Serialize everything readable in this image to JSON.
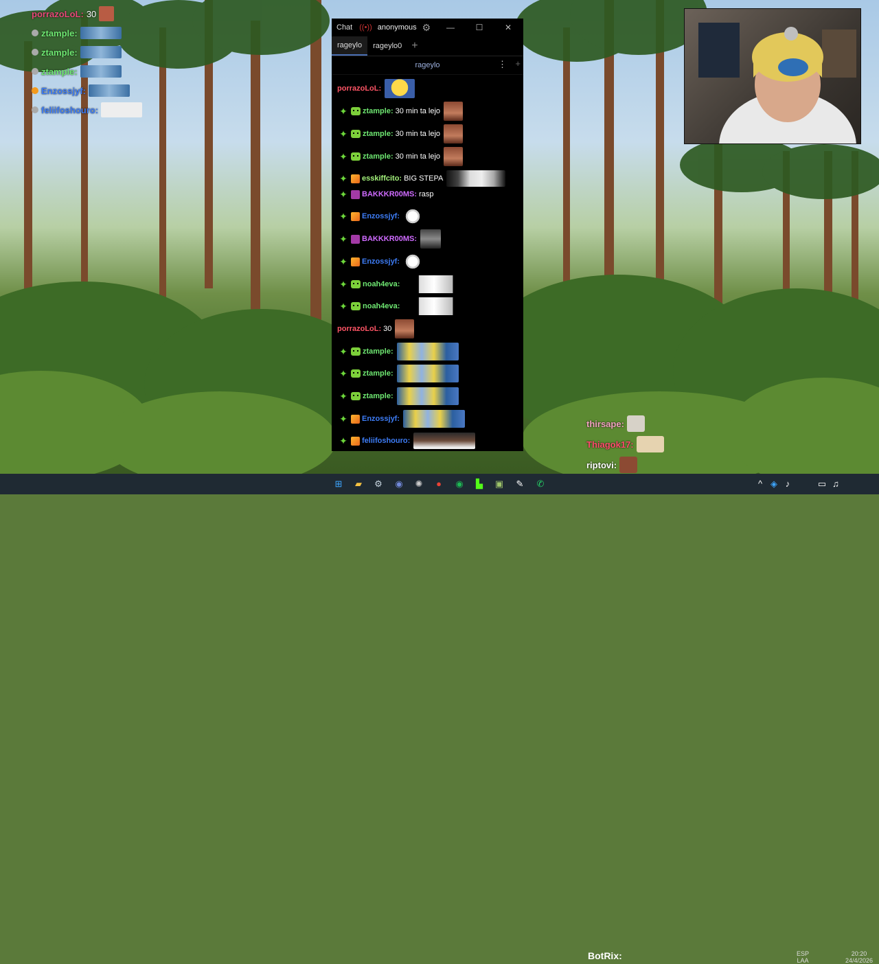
{
  "overlay_chat": [
    {
      "name": "porrazoLoL:",
      "message": "30"
    },
    {
      "name": "ztample:",
      "message": ""
    },
    {
      "name": "ztample:",
      "message": ""
    },
    {
      "name": "ztample:",
      "message": ""
    },
    {
      "name": "Enzossjyf:",
      "message": ""
    },
    {
      "name": "feliifoshouro:",
      "message": ""
    }
  ],
  "window": {
    "title": "Chat",
    "user": "anonymous",
    "tabs": [
      "rageylo",
      "rageylo0"
    ],
    "add_tab": "+",
    "channel": "rageylo",
    "more": "⋮",
    "add_split": "+"
  },
  "messages": [
    {
      "user": "porrazoLoL:",
      "text": "",
      "badges": [],
      "color": "red"
    },
    {
      "user": "ztample:",
      "text": "30 min ta lejo",
      "badges": [
        "star",
        "robot"
      ],
      "color": "green"
    },
    {
      "user": "ztample:",
      "text": "30 min ta lejo",
      "badges": [
        "star",
        "robot"
      ],
      "color": "green"
    },
    {
      "user": "ztample:",
      "text": "30 min ta lejo",
      "badges": [
        "star",
        "robot"
      ],
      "color": "green"
    },
    {
      "user": "esskiffcito:",
      "text": "BIG STEPA",
      "badges": [
        "star",
        "box"
      ],
      "color": "green2"
    },
    {
      "user": "BAKKKR00MS:",
      "text": "rasp",
      "badges": [
        "star",
        "prime"
      ],
      "color": "purple"
    },
    {
      "user": "Enzossjyf:",
      "text": "",
      "badges": [
        "star",
        "box"
      ],
      "color": "blue"
    },
    {
      "user": "BAKKKR00MS:",
      "text": "",
      "badges": [
        "star",
        "prime"
      ],
      "color": "purple"
    },
    {
      "user": "Enzossjyf:",
      "text": "",
      "badges": [
        "star",
        "box"
      ],
      "color": "blue"
    },
    {
      "user": "noah4eva:",
      "text": "",
      "badges": [
        "star",
        "robot"
      ],
      "color": "green"
    },
    {
      "user": "noah4eva:",
      "text": "",
      "badges": [
        "star",
        "robot"
      ],
      "color": "green"
    },
    {
      "user": "porrazoLoL:",
      "text": "30",
      "badges": [],
      "color": "red"
    },
    {
      "user": "ztample:",
      "text": "",
      "badges": [
        "star",
        "robot"
      ],
      "color": "green"
    },
    {
      "user": "ztample:",
      "text": "",
      "badges": [
        "star",
        "robot"
      ],
      "color": "green"
    },
    {
      "user": "ztample:",
      "text": "",
      "badges": [
        "star",
        "robot"
      ],
      "color": "green"
    },
    {
      "user": "Enzossjyf:",
      "text": "",
      "badges": [
        "star",
        "box"
      ],
      "color": "blue"
    },
    {
      "user": "feliifoshouro:",
      "text": "",
      "badges": [
        "star",
        "box"
      ],
      "color": "blue"
    }
  ],
  "overlay_chat_2": [
    {
      "name": "thirsape:",
      "color": "#f2a3c0"
    },
    {
      "name": "Thiagok17:",
      "color": "#ff4d6d"
    },
    {
      "name": "riptovi:",
      "color": "#ffffff"
    }
  ],
  "taskbar": {
    "botrix_label": "BotRix:",
    "lang_top": "ESP",
    "lang_bottom": "LAA",
    "time": "20:20",
    "date": "24/4/2026"
  },
  "colors": {
    "window_bg": "#000000",
    "tab_accent": "#4a6fb5",
    "taskbar_bg": "#1f2a33"
  }
}
